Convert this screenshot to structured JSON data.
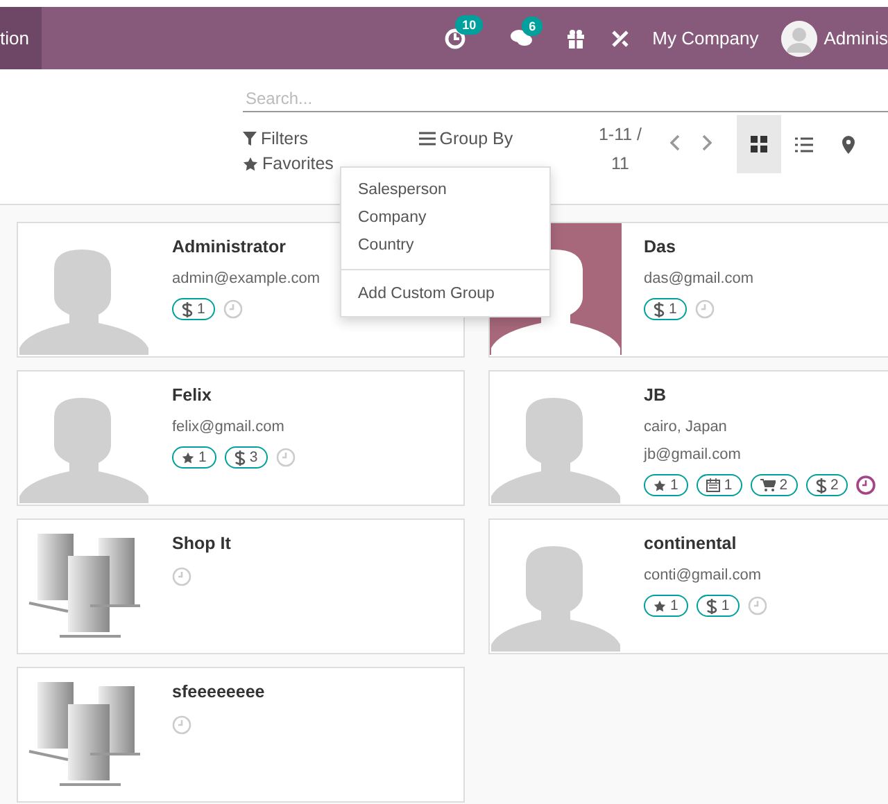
{
  "navbar": {
    "app_title": "tion",
    "activity_count": "10",
    "message_count": "6",
    "company": "My Company",
    "user": "Adminis"
  },
  "control_panel": {
    "search": {
      "placeholder": "Search..."
    },
    "filters": "Filters",
    "group_by": "Group By",
    "favorites": "Favorites",
    "pager": "1-11 / 11",
    "views": [
      {
        "kind": "kanban",
        "selected": true
      },
      {
        "kind": "list",
        "selected": false
      },
      {
        "kind": "map",
        "selected": false
      }
    ]
  },
  "group_by_menu": {
    "options": [
      "Salesperson",
      "Company",
      "Country"
    ],
    "custom_group": "Add Custom Group"
  },
  "cards": [
    {
      "name": "Administrator",
      "kind": "person",
      "lines": [
        "admin@example.com"
      ],
      "tags": [
        {
          "kind": "dollar",
          "count": "1"
        }
      ],
      "overdue": false
    },
    {
      "name": "Das",
      "kind": "photo",
      "lines": [
        "das@gmail.com"
      ],
      "tags": [
        {
          "kind": "dollar",
          "count": "1"
        }
      ],
      "overdue": false
    },
    {
      "name": "Felix",
      "kind": "person",
      "lines": [
        "felix@gmail.com"
      ],
      "tags": [
        {
          "kind": "star",
          "count": "1"
        },
        {
          "kind": "dollar",
          "count": "3"
        }
      ],
      "overdue": false
    },
    {
      "name": "JB",
      "kind": "person",
      "lines": [
        "cairo, Japan",
        "jb@gmail.com"
      ],
      "tags": [
        {
          "kind": "star",
          "count": "1"
        },
        {
          "kind": "calendar",
          "count": "1"
        },
        {
          "kind": "cart",
          "count": "2"
        },
        {
          "kind": "dollar",
          "count": "2"
        }
      ],
      "overdue": true
    },
    {
      "name": "Shop It",
      "kind": "company",
      "overdue": false
    },
    {
      "name": "continental",
      "kind": "person",
      "lines": [
        "conti@gmail.com"
      ],
      "tags": [
        {
          "kind": "star",
          "count": "1"
        },
        {
          "kind": "dollar",
          "count": "1"
        }
      ],
      "overdue": false
    },
    {
      "name": "sfeeeeeeee",
      "kind": "company",
      "overdue": false
    }
  ]
}
